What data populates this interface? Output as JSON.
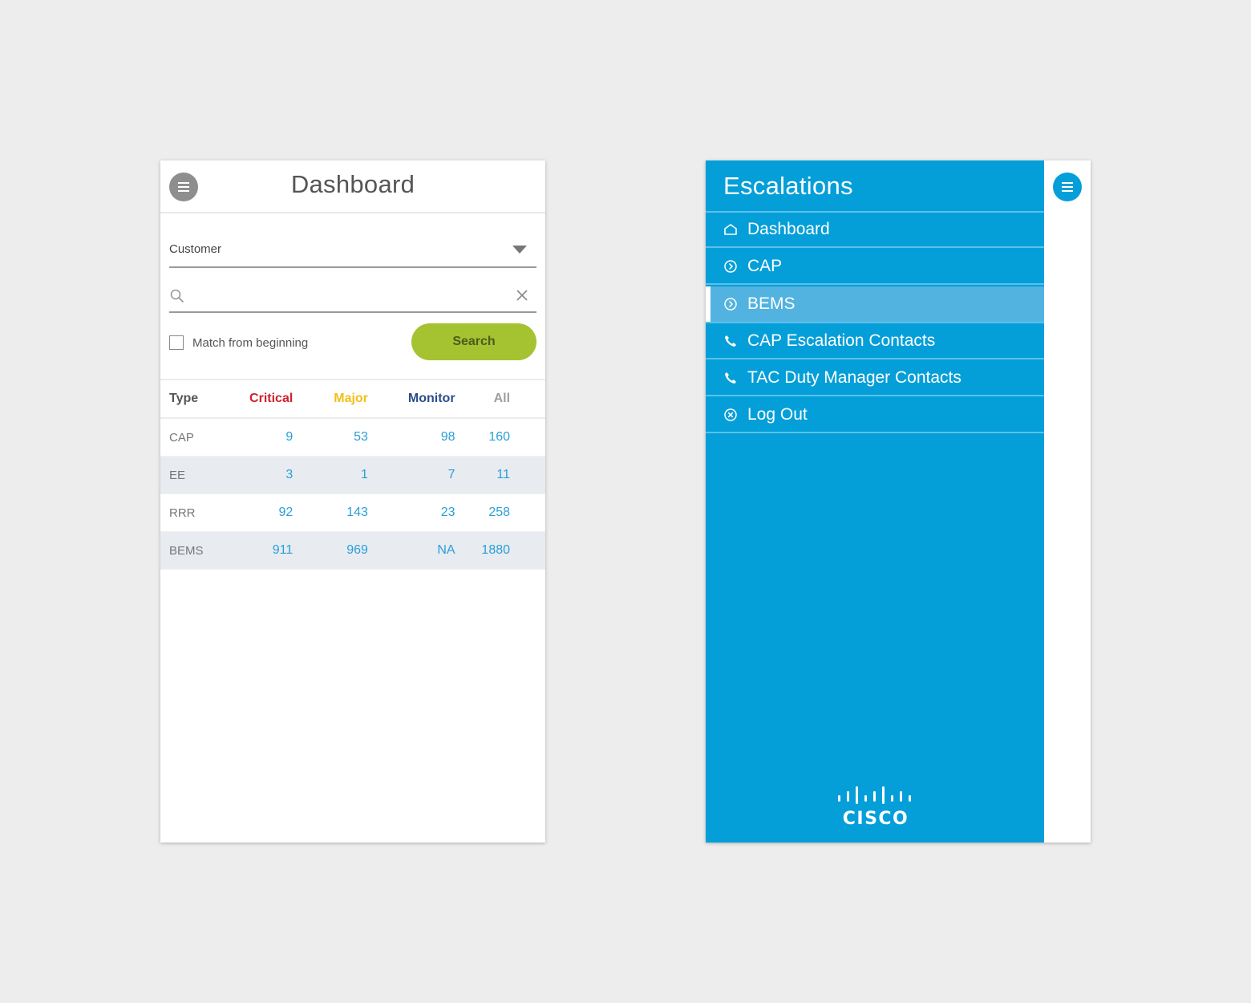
{
  "dashboard": {
    "title": "Dashboard",
    "menu_icon": "hamburger-icon",
    "customer_select": {
      "selected": "Customer",
      "icon": "chevron-down-icon"
    },
    "search": {
      "value": "",
      "placeholder": "",
      "icon": "search-icon",
      "clear_icon": "close-icon"
    },
    "match_from_beginning": {
      "label": "Match from beginning",
      "checked": false
    },
    "search_button": {
      "label": "Search",
      "color": "#a5c231"
    },
    "table": {
      "headers": [
        {
          "label": "Type",
          "color": "#555555"
        },
        {
          "label": "Critical",
          "color": "#cf2030"
        },
        {
          "label": "Major",
          "color": "#f2c018"
        },
        {
          "label": "Monitor",
          "color": "#2b4c8c"
        },
        {
          "label": "All",
          "color": "#9e9e9e"
        }
      ],
      "rows": [
        {
          "type": "CAP",
          "critical": "9",
          "major": "53",
          "monitor": "98",
          "all": "160"
        },
        {
          "type": "EE",
          "critical": "3",
          "major": "1",
          "monitor": "7",
          "all": "11"
        },
        {
          "type": "RRR",
          "critical": "92",
          "major": "143",
          "monitor": "23",
          "all": "258"
        },
        {
          "type": "BEMS",
          "critical": "911",
          "major": "969",
          "monitor": "NA",
          "all": "1880"
        }
      ],
      "value_color": "#2a9fd8"
    }
  },
  "escalations_menu": {
    "title": "Escalations",
    "accent": "#049fd9",
    "items": [
      {
        "label": "Dashboard",
        "icon": "home-icon",
        "active": false
      },
      {
        "label": "CAP",
        "icon": "chevron-circle-right-icon",
        "active": false
      },
      {
        "label": "BEMS",
        "icon": "chevron-circle-right-icon",
        "active": true
      },
      {
        "label": "CAP Escalation Contacts",
        "icon": "phone-icon",
        "active": false
      },
      {
        "label": "TAC Duty Manager Contacts",
        "icon": "phone-icon",
        "active": false
      },
      {
        "label": "Log Out",
        "icon": "close-circle-icon",
        "active": false
      }
    ],
    "logo": {
      "text": "CISCO"
    },
    "menu_icon": "hamburger-icon"
  }
}
